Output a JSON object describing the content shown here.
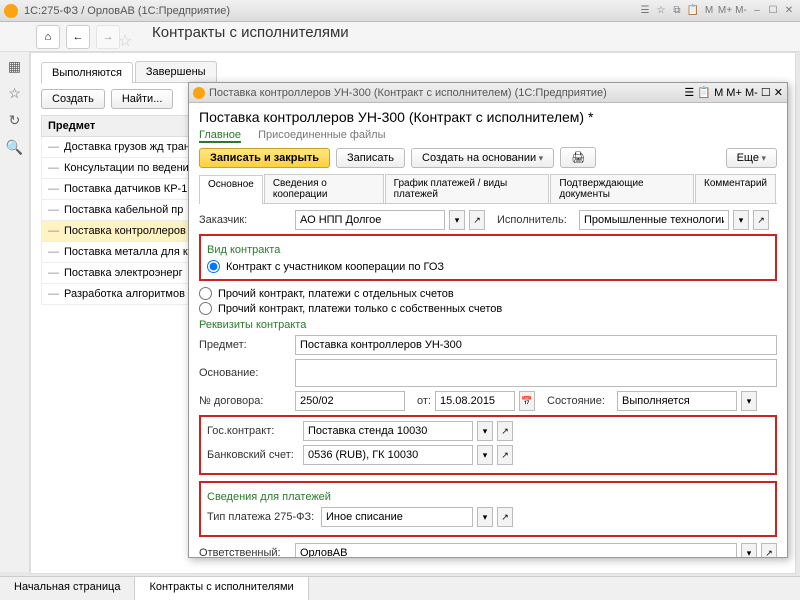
{
  "app": {
    "title": "1С:275-ФЗ / ОрловАВ   (1С:Предприятие)"
  },
  "page": {
    "title": "Контракты с исполнителями"
  },
  "mainTabs": {
    "active": "Выполняются",
    "other": "Завершены"
  },
  "toolbar": {
    "create": "Создать",
    "find": "Найти..."
  },
  "listHeader": "Предмет",
  "listItems": [
    "Доставка грузов жд транс",
    "Консультации по ведени",
    "Поставка датчиков КР-1",
    "Поставка кабельной пр",
    "Поставка контроллеров",
    "Поставка металла для к",
    "Поставка электроэнерг",
    "Разработка алгоритмов"
  ],
  "dialog": {
    "winTitle": "Поставка контроллеров УН-300 (Контракт с исполнителем)   (1С:Предприятие)",
    "title": "Поставка контроллеров УН-300 (Контракт с исполнителем) *",
    "links": {
      "main": "Главное",
      "files": "Присоединенные файлы"
    },
    "buttons": {
      "saveClose": "Записать и закрыть",
      "save": "Записать",
      "createBased": "Создать на основании",
      "more": "Еще"
    },
    "innerTabs": [
      "Основное",
      "Сведения о кооперации",
      "График платежей / виды платежей",
      "Подтверждающие документы",
      "Комментарий"
    ],
    "customerLabel": "Заказчик:",
    "customer": "АО НПП Долгое",
    "executorLabel": "Исполнитель:",
    "executor": "Промышленные технологии",
    "section1": "Вид контракта",
    "radio1": "Контракт с участником кооперации по ГОЗ",
    "radio2": "Прочий контракт, платежи с отдельных счетов",
    "radio3": "Прочий контракт, платежи только с собственных счетов",
    "section2": "Реквизиты контракта",
    "subjectLabel": "Предмет:",
    "subject": "Поставка контроллеров УН-300",
    "basisLabel": "Основание:",
    "basis": "",
    "docNumLabel": "№ договора:",
    "docNum": "250/02",
    "dateLabel": "от:",
    "date": "15.08.2015",
    "stateLabel": "Состояние:",
    "state": "Выполняется",
    "gosLabel": "Гос.контракт:",
    "gos": "Поставка стенда 10030",
    "bankLabel": "Банковский счет:",
    "bank": "0536 (RUB), ГК 10030",
    "section3": "Сведения для платежей",
    "payTypeLabel": "Тип платежа 275-ФЗ:",
    "payType": "Иное списание",
    "respLabel": "Ответственный:",
    "resp": "ОрловАВ"
  },
  "bottomTabs": {
    "start": "Начальная страница",
    "current": "Контракты с исполнителями"
  }
}
